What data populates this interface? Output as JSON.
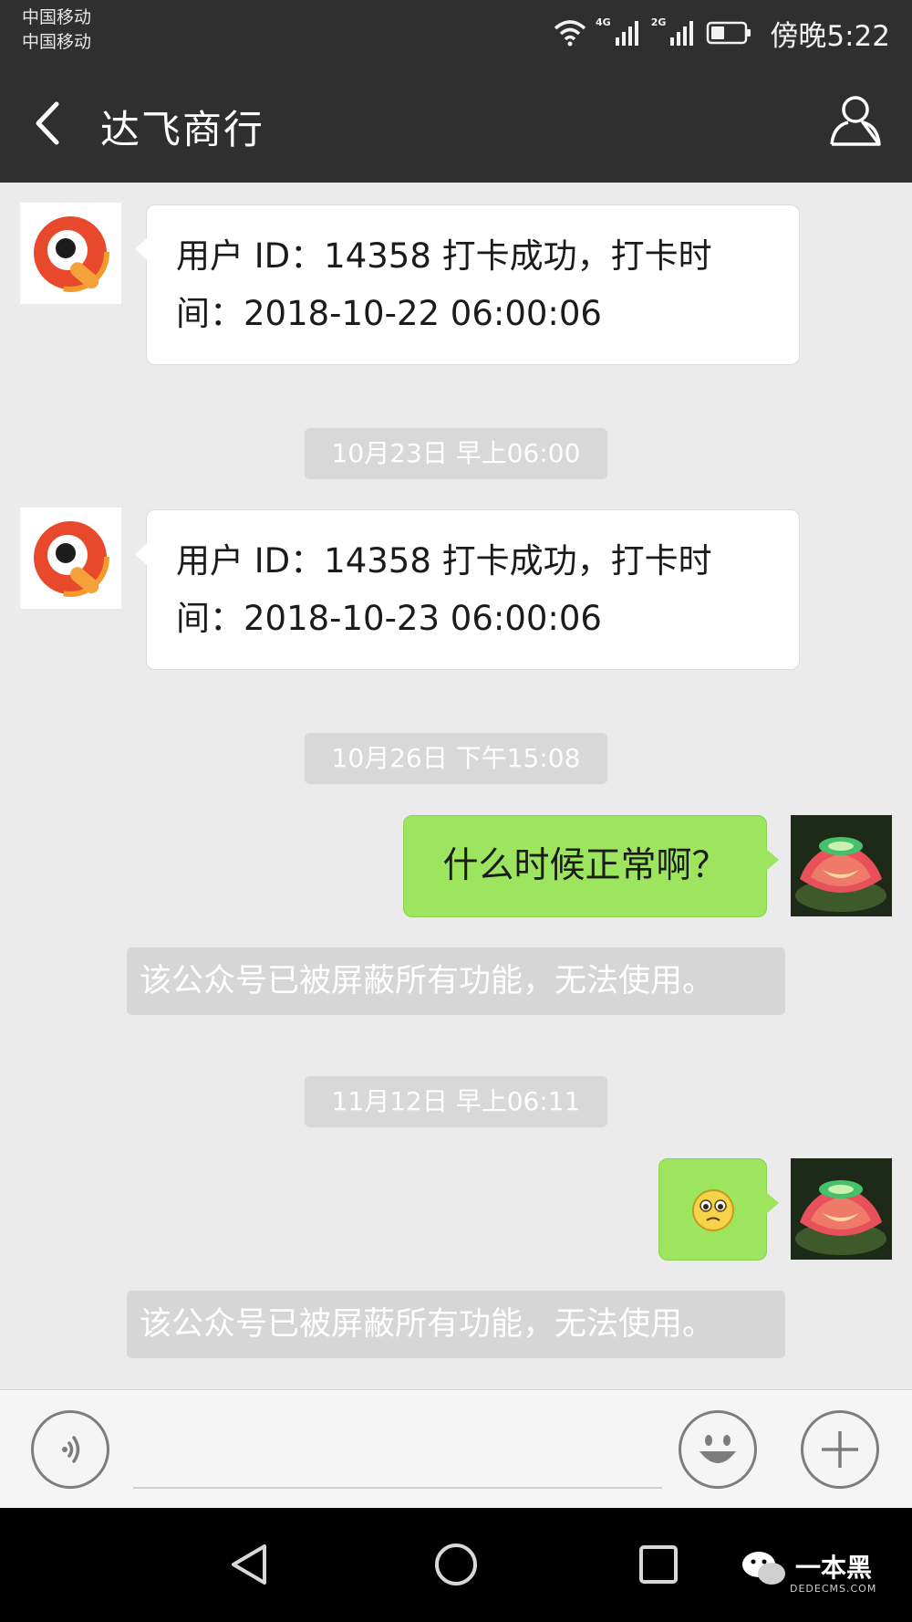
{
  "status_bar": {
    "carrier_1": "中国移动",
    "carrier_2": "中国移动",
    "net_1": "4G",
    "net_2": "2G",
    "time": "傍晚5:22"
  },
  "header": {
    "title": "达飞商行",
    "back_icon": "chevron-left-icon",
    "profile_icon": "person-icon"
  },
  "messages": [
    {
      "kind": "incoming",
      "line_1": "用户 ID：14358 打卡成功，打卡时",
      "line_2": "间：2018-10-22 06:00:06"
    },
    {
      "kind": "timestamp",
      "text": "10月23日 早上06:00"
    },
    {
      "kind": "incoming",
      "line_1": "用户 ID：14358 打卡成功，打卡时",
      "line_2": "间：2018-10-23 06:00:06"
    },
    {
      "kind": "timestamp",
      "text": "10月26日 下午15:08"
    },
    {
      "kind": "outgoing",
      "text": "什么时候正常啊？"
    },
    {
      "kind": "system",
      "text": "该公众号已被屏蔽所有功能，无法使用。"
    },
    {
      "kind": "timestamp",
      "text": "11月12日 早上06:11"
    },
    {
      "kind": "outgoing",
      "emoji": "pleading-face-emoji"
    },
    {
      "kind": "system",
      "text": "该公众号已被屏蔽所有功能，无法使用。"
    }
  ],
  "input_bar": {
    "voice_icon": "voice-icon",
    "emoji_icon": "smiley-icon",
    "plus_icon": "plus-icon",
    "placeholder": ""
  },
  "nav_bar": {
    "back_icon": "triangle-back-icon",
    "home_icon": "circle-home-icon",
    "recents_icon": "square-recents-icon"
  },
  "watermark": {
    "text": "一本黑",
    "sub": "DEDECMS.COM"
  },
  "colors": {
    "header_bg": "#2f2f2f",
    "chat_bg": "#ebebeb",
    "outgoing_bubble": "#9de55e",
    "incoming_bubble": "#ffffff"
  }
}
